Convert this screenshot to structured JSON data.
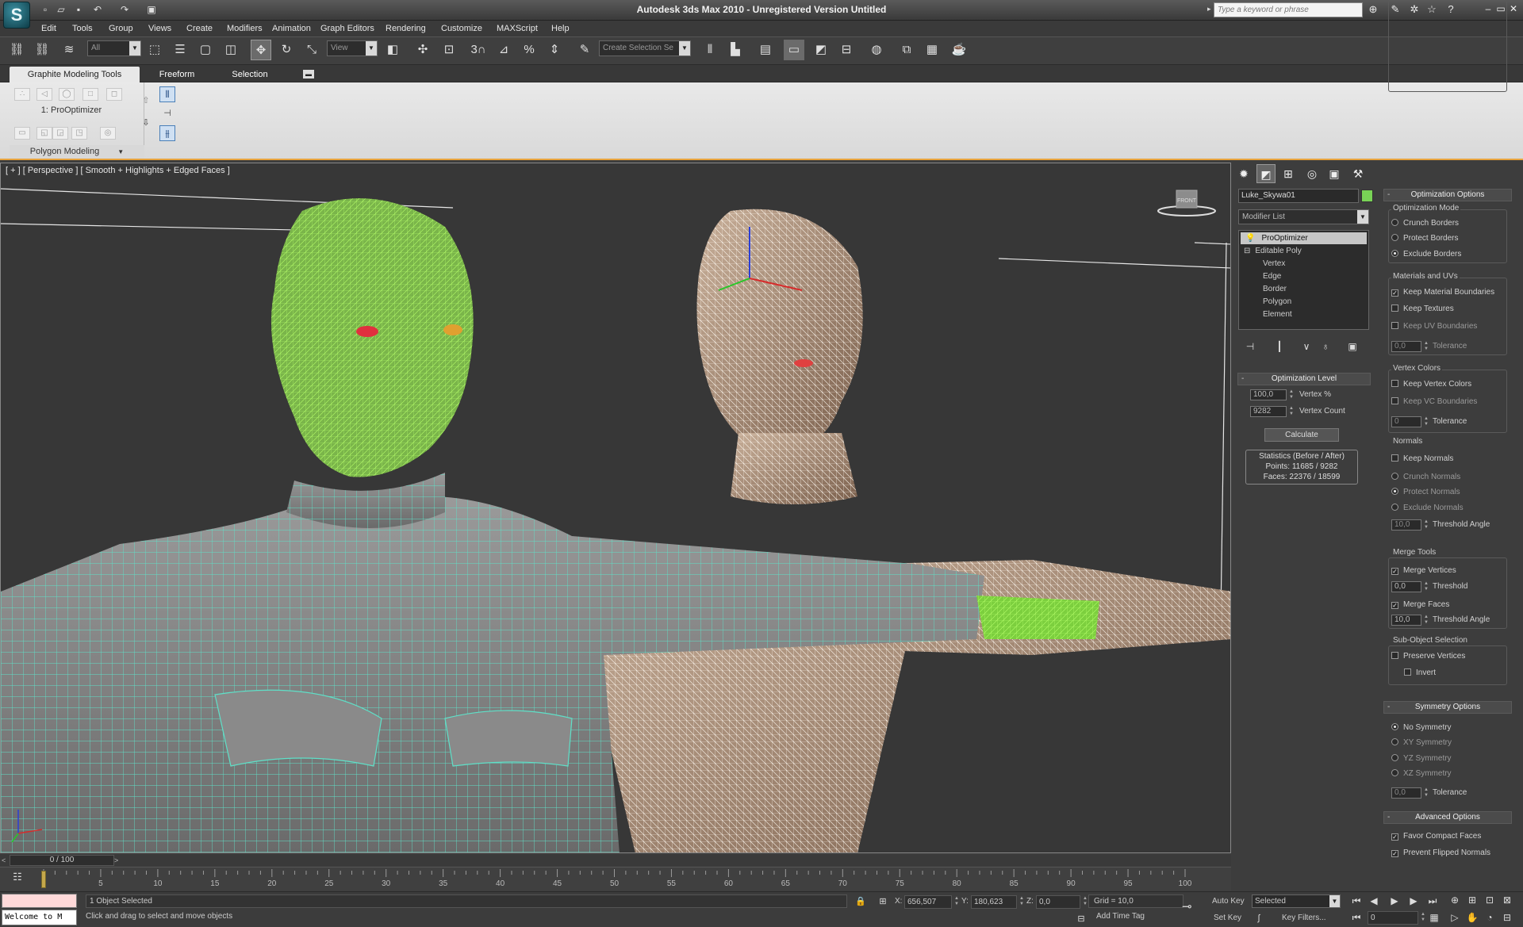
{
  "window": {
    "title": "Autodesk 3ds Max 2010 - Unregistered Version    Untitled",
    "logo_glyph": "S",
    "search_placeholder": "Type a keyword or phrase",
    "controls": {
      "minimize": "–",
      "restore": "▭",
      "close": "✕"
    }
  },
  "menu": [
    "Edit",
    "Tools",
    "Group",
    "Views",
    "Create",
    "Modifiers",
    "Animation",
    "Graph Editors",
    "Rendering",
    "Customize",
    "MAXScript",
    "Help"
  ],
  "toolbar": {
    "filter_dropdown": "All",
    "view_dropdown": "View",
    "snap_toggle_3": "3",
    "snap_toggle_2_5": "2,5",
    "named_selection_set": "Create Selection Se"
  },
  "ribbon": {
    "tabs": [
      "Graphite Modeling Tools",
      "Freeform",
      "Selection"
    ],
    "active_tab": 0,
    "panel_label": "1: ProOptimizer",
    "panel_footer": "Polygon Modeling"
  },
  "viewport": {
    "label": "[ + ] [ Perspective ] [ Smooth + Highlights + Edged Faces ]",
    "viewcube_label": "FRONT"
  },
  "command_panel": {
    "object_name": "Luke_Skywa01",
    "object_color": "#79d356",
    "modifier_list": "Modifier List",
    "stack": [
      {
        "label": "ProOptimizer",
        "active": true
      },
      {
        "label": "Editable Poly"
      },
      {
        "label": "Vertex"
      },
      {
        "label": "Edge"
      },
      {
        "label": "Border"
      },
      {
        "label": "Polygon"
      },
      {
        "label": "Element"
      }
    ],
    "optimization_level": {
      "title": "Optimization Level",
      "vertex_percent_value": "100,0",
      "vertex_percent_label": "Vertex %",
      "vertex_count_value": "9282",
      "vertex_count_label": "Vertex Count",
      "calculate_button": "Calculate",
      "stats_title": "Statistics (Before / After)",
      "points": "Points: 11685 / 9282",
      "faces": "Faces: 22376 / 18599"
    },
    "optimization_options": {
      "title": "Optimization Options",
      "mode_group": "Optimization Mode",
      "modes": [
        "Crunch Borders",
        "Protect Borders",
        "Exclude Borders"
      ],
      "mode_selected": 2,
      "materials_group": "Materials and UVs",
      "keep_material_boundaries": "Keep Material Boundaries",
      "keep_textures": "Keep Textures",
      "keep_uv_boundaries": "Keep UV Boundaries",
      "uv_tolerance_value": "0,0",
      "tolerance_label": "Tolerance",
      "vertex_colors_group": "Vertex Colors",
      "keep_vertex_colors": "Keep Vertex Colors",
      "keep_vc_boundaries": "Keep VC Boundaries",
      "vc_tolerance_value": "0",
      "normals_group": "Normals",
      "keep_normals": "Keep Normals",
      "normal_modes": [
        "Crunch Normals",
        "Protect Normals",
        "Exclude Normals"
      ],
      "normal_selected": 1,
      "normals_threshold_value": "10,0",
      "threshold_angle_label": "Threshold Angle",
      "merge_group": "Merge Tools",
      "merge_vertices": "Merge Vertices",
      "merge_threshold_value": "0,0",
      "threshold_label": "Threshold",
      "merge_faces": "Merge Faces",
      "merge_faces_angle_value": "10,0",
      "subobject_group": "Sub-Object Selection",
      "preserve_vertices": "Preserve Vertices",
      "invert": "Invert"
    },
    "symmetry": {
      "title": "Symmetry Options",
      "modes": [
        "No Symmetry",
        "XY Symmetry",
        "YZ Symmetry",
        "XZ Symmetry"
      ],
      "selected": 0,
      "tolerance_value": "0,0",
      "tolerance_label": "Tolerance"
    },
    "advanced": {
      "title": "Advanced Options",
      "favor_compact_faces": "Favor Compact Faces",
      "prevent_flipped_normals": "Prevent Flipped Normals"
    }
  },
  "timeline": {
    "slider_text": "0 / 100",
    "ticks": [
      "5",
      "10",
      "15",
      "20",
      "25",
      "30",
      "35",
      "40",
      "45",
      "50",
      "55",
      "60",
      "65",
      "70",
      "75",
      "80",
      "85",
      "90",
      "95",
      "100"
    ]
  },
  "status": {
    "welcome": "Welcome to M",
    "selection": "1 Object Selected",
    "prompt": "Click and drag to select and move objects",
    "x_label": "X:",
    "x_value": "656,507",
    "y_label": "Y:",
    "y_value": "180,623",
    "z_label": "Z:",
    "z_value": "0,0",
    "grid": "Grid = 10,0",
    "add_time_tag": "Add Time Tag",
    "auto_key": "Auto Key",
    "set_key": "Set Key",
    "selected_dropdown": "Selected",
    "key_filters": "Key Filters...",
    "current_frame": "0"
  }
}
